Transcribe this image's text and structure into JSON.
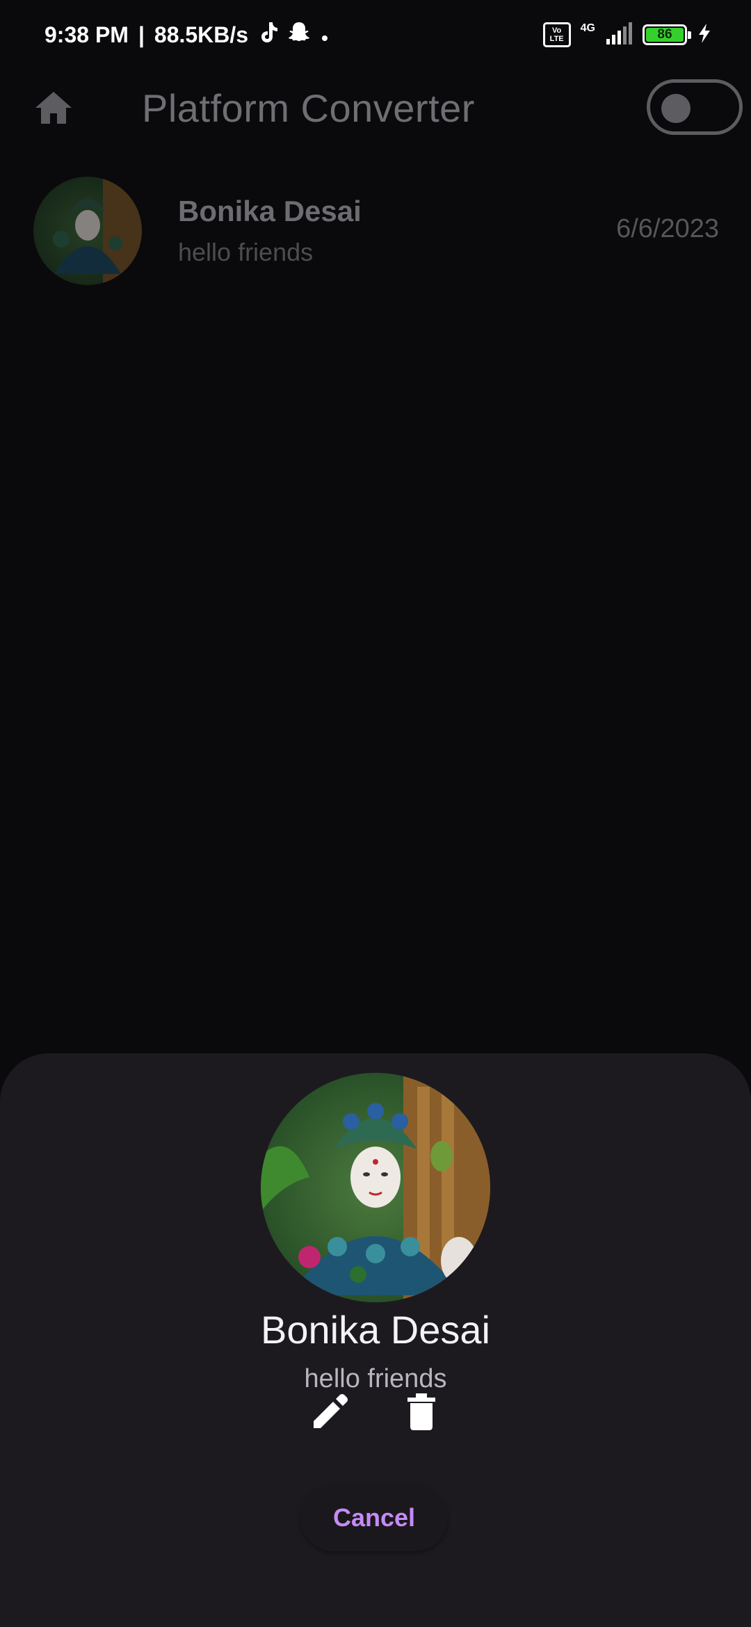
{
  "status_bar": {
    "time": "9:38 PM",
    "speed": "88.5KB/s",
    "volte": "Vo LTE",
    "network_type": "4G",
    "battery": "86",
    "icons": [
      "tiktok-icon",
      "snapchat-icon",
      "signal-icon",
      "charging-icon"
    ]
  },
  "app_bar": {
    "title": "Platform Converter",
    "toggle_on": false
  },
  "contacts": [
    {
      "name": "Bonika Desai",
      "message": "hello friends",
      "date": "6/6/2023"
    }
  ],
  "sheet": {
    "name": "Bonika Desai",
    "message": "hello friends",
    "cancel_label": "Cancel",
    "actions": [
      "edit-icon",
      "delete-icon"
    ]
  },
  "colors": {
    "background": "#0a090b",
    "sheet": "#1c1a1f",
    "accent": "#c58bf5",
    "battery": "#35d02e"
  }
}
